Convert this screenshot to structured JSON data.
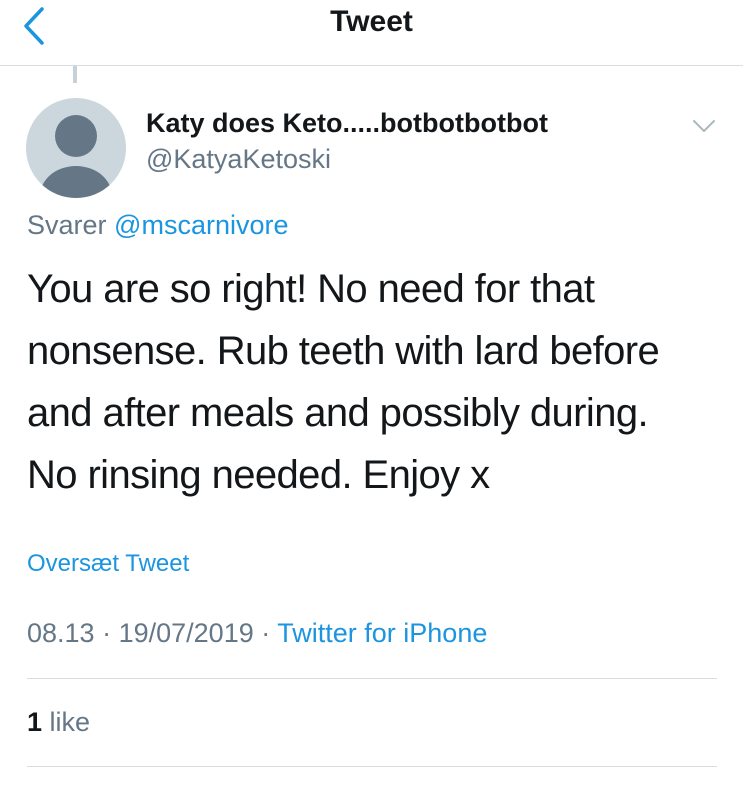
{
  "navbar": {
    "title": "Tweet",
    "back_icon": "chevron-left-icon"
  },
  "tweet": {
    "author": {
      "display_name": "Katy does Keto.....botbotbotbot",
      "handle": "@KatyaKetoski",
      "avatar": "default-avatar"
    },
    "caret_icon": "chevron-down-icon",
    "reply": {
      "prefix": "Svarer",
      "mention": "@mscarnivore"
    },
    "text_lines": [
      "You are so right! No need for that",
      "nonsense. Rub teeth with lard before",
      "and after meals and possibly during.",
      "No rinsing needed. Enjoy x"
    ],
    "translate_label": "Oversæt Tweet",
    "time": "08.13",
    "date": "19/07/2019",
    "source": "Twitter for iPhone",
    "likes": {
      "count": "1",
      "label": "like"
    }
  },
  "colors": {
    "accent": "#1b95e0",
    "muted": "#657786",
    "text": "#14171a",
    "divider": "#d8dde2",
    "avatar_bg": "#ccd6dd",
    "avatar_fg": "#657786"
  }
}
